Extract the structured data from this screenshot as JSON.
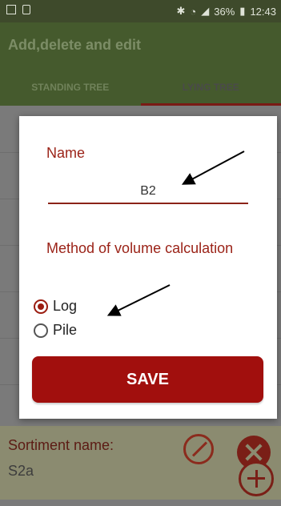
{
  "status_bar": {
    "battery": "36%",
    "time": "12:43"
  },
  "app": {
    "title": "Add,delete and edit"
  },
  "tabs": [
    {
      "label": "STANDING TREE"
    },
    {
      "label": "LYING TREE"
    }
  ],
  "dialog": {
    "name_label": "Name",
    "name_value": "B2",
    "method_label": "Method of volume calculation",
    "options": [
      {
        "label": "Log",
        "checked": true
      },
      {
        "label": "Pile",
        "checked": false
      }
    ],
    "save_label": "SAVE"
  },
  "list_item": {
    "label": "Sortiment name:",
    "value": "S2a"
  },
  "colors": {
    "accent": "#9b2318",
    "primary_green": "#455a2d"
  }
}
